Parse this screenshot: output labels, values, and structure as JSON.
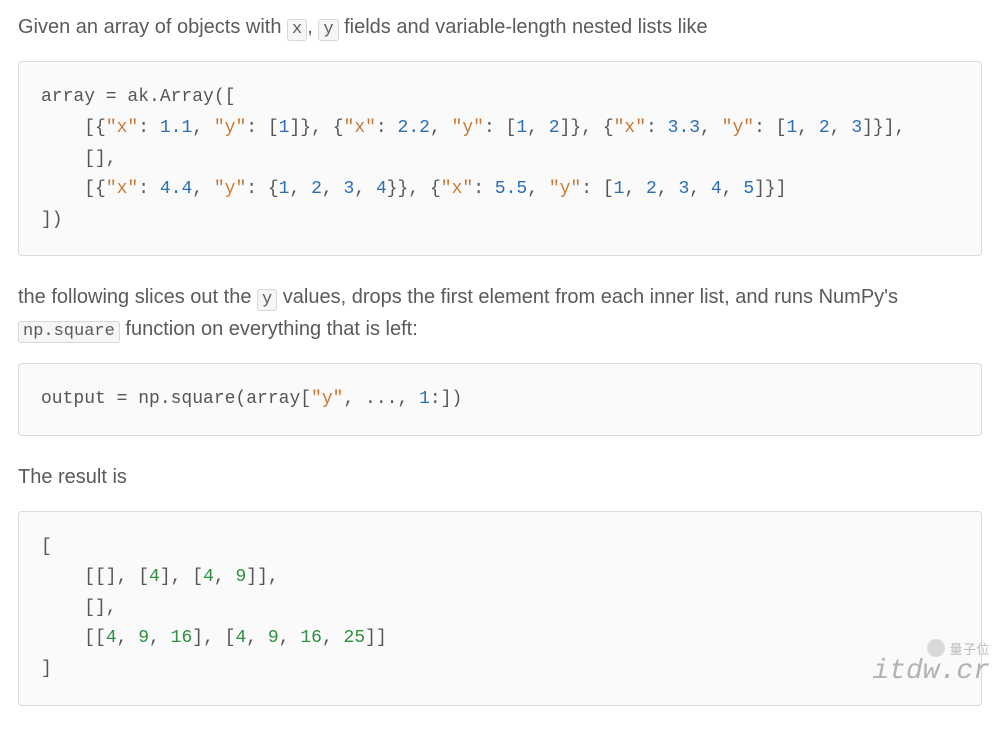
{
  "para1": {
    "t1": "Given an array of objects with ",
    "c1": "x",
    "t2": ", ",
    "c2": "y",
    "t3": " fields and variable-length nested lists like"
  },
  "code1": {
    "l1a": "array = ak.Array([",
    "l2pad": "    [",
    "l2a_open": "{",
    "l2a_kx": "\"x\"",
    "l2a_colon": ": ",
    "l2a_vx": "1.1",
    "l2a_mid": ", ",
    "l2a_ky": "\"y\"",
    "l2a_colon2": ": [",
    "l2a_vy": "1",
    "l2a_close": "]}",
    "sep": ", ",
    "l2b_open": "{",
    "l2b_kx": "\"x\"",
    "l2b_colon": ": ",
    "l2b_vx": "2.2",
    "l2b_mid": ", ",
    "l2b_ky": "\"y\"",
    "l2b_colon2": ": [",
    "l2b_vy1": "1",
    "l2b_comma": ", ",
    "l2b_vy2": "2",
    "l2b_close": "]}",
    "l2c_open": "{",
    "l2c_kx": "\"x\"",
    "l2c_colon": ": ",
    "l2c_vx": "3.3",
    "l2c_mid": ", ",
    "l2c_ky": "\"y\"",
    "l2c_colon2": ": [",
    "l2c_vy1": "1",
    "l2c_vy2": "2",
    "l2c_vy3": "3",
    "l2c_close": "]}",
    "l2end": "],",
    "l3": "    [],",
    "l4pad": "    [",
    "l4a_open": "{",
    "l4a_kx": "\"x\"",
    "l4a_colon": ": ",
    "l4a_vx": "4.4",
    "l4a_mid": ", ",
    "l4a_ky": "\"y\"",
    "l4a_colon2": ": {",
    "l4a_vy1": "1",
    "l4a_vy2": "2",
    "l4a_vy3": "3",
    "l4a_vy4": "4",
    "l4a_close": "}}",
    "l4b_open": "{",
    "l4b_kx": "\"x\"",
    "l4b_colon": ": ",
    "l4b_vx": "5.5",
    "l4b_mid": ", ",
    "l4b_ky": "\"y\"",
    "l4b_colon2": ": [",
    "l4b_vy1": "1",
    "l4b_vy2": "2",
    "l4b_vy3": "3",
    "l4b_vy4": "4",
    "l4b_vy5": "5",
    "l4b_close": "]}",
    "l4end": "]",
    "l5": "])"
  },
  "para2": {
    "t1": "the following slices out the ",
    "c1": "y",
    "t2": " values, drops the first element from each inner list, and runs NumPy's ",
    "c2": "np.square",
    "t3": " function on everything that is left:"
  },
  "code2": {
    "lhs": "output = np.square(array[",
    "s1": "\"y\"",
    "mid": ", ..., ",
    "n1": "1",
    "tail": ":])"
  },
  "para3": "The result is",
  "code3": {
    "l1": "[",
    "l2a": "    [[], [",
    "l2_n1": "4",
    "l2b": "], [",
    "l2_n2": "4",
    "l2c": ", ",
    "l2_n3": "9",
    "l2d": "]],",
    "l3": "    [],",
    "l4a": "    [[",
    "l4_n1": "4",
    "l4b": ", ",
    "l4_n2": "9",
    "l4c": ", ",
    "l4_n3": "16",
    "l4d": "], [",
    "l4_n4": "4",
    "l4e": ", ",
    "l4_n5": "9",
    "l4f": ", ",
    "l4_n6": "16",
    "l4g": ", ",
    "l4_n7": "25",
    "l4h": "]]",
    "l5": "]"
  },
  "watermark": {
    "small": "量子位",
    "big": "itdw.cr"
  }
}
